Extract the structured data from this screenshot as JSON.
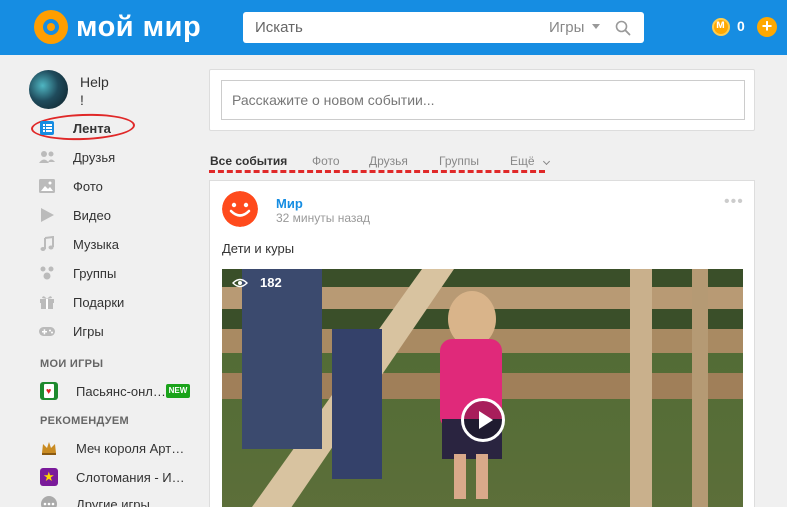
{
  "header": {
    "logo_text": "мой мир",
    "search_placeholder": "Искать",
    "search_category": "Игры",
    "coin_count": "0"
  },
  "sidebar": {
    "username_line1": "Help",
    "username_line2": "!",
    "items": [
      {
        "label": "Лента",
        "icon": "feed-icon"
      },
      {
        "label": "Друзья",
        "icon": "friends-icon"
      },
      {
        "label": "Фото",
        "icon": "photo-icon"
      },
      {
        "label": "Видео",
        "icon": "video-icon"
      },
      {
        "label": "Музыка",
        "icon": "music-icon"
      },
      {
        "label": "Группы",
        "icon": "groups-icon"
      },
      {
        "label": "Подарки",
        "icon": "gifts-icon"
      },
      {
        "label": "Игры",
        "icon": "games-icon"
      }
    ],
    "my_games_title": "МОИ ИГРЫ",
    "my_games": [
      {
        "label": "Пасьянс-онл…",
        "badge": "NEW"
      }
    ],
    "recommend_title": "РЕКОМЕНДУЕМ",
    "recommended": [
      {
        "label": "Меч короля Арт…"
      },
      {
        "label": "Слотомания - И…"
      },
      {
        "label": "Другие игры"
      }
    ]
  },
  "composer": {
    "placeholder": "Расскажите о новом событии..."
  },
  "tabs": [
    "Все события",
    "Фото",
    "Друзья",
    "Группы",
    "Ещё"
  ],
  "post": {
    "author": "Мир",
    "time": "32 минуты назад",
    "text": "Дети и куры",
    "views": "182"
  },
  "colors": {
    "header_bg": "#168de2",
    "accent_orange": "#ffa800",
    "link_blue": "#168de2",
    "highlight_red": "#e02828",
    "new_badge": "#1aa31a"
  }
}
